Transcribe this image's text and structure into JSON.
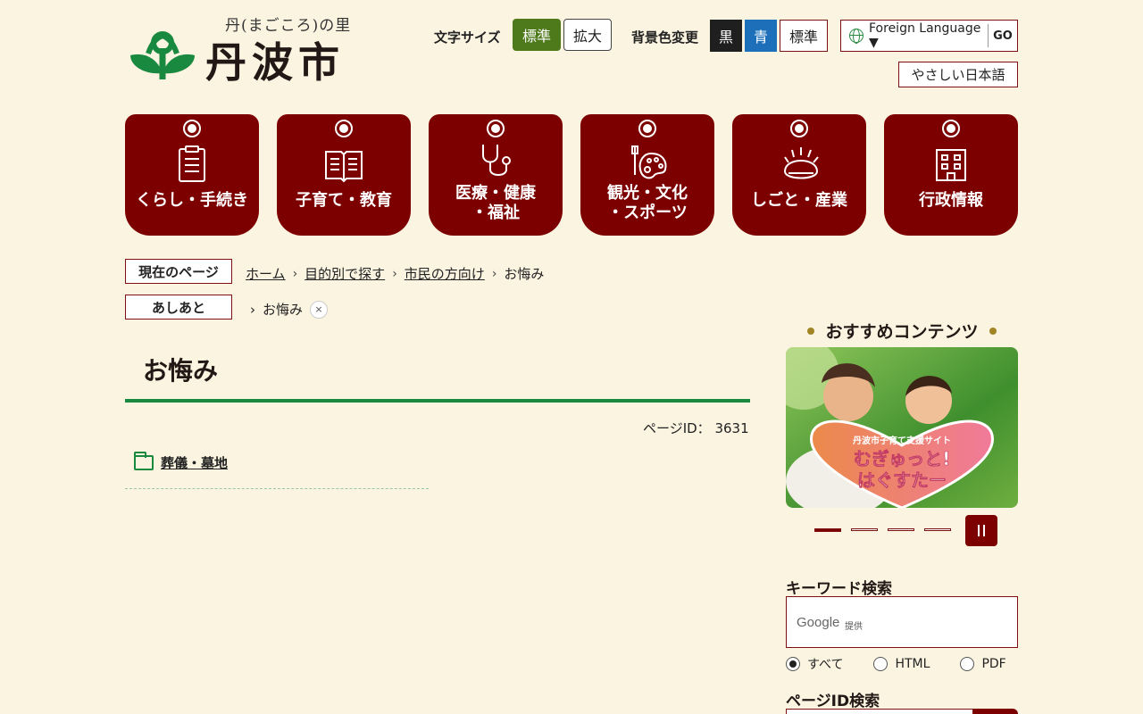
{
  "header": {
    "tagline": "丹(まごころ)の里",
    "city_name": "丹波市",
    "font_size_label": "文字サイズ",
    "font_size_standard": "標準",
    "font_size_large": "拡大",
    "bg_label": "背景色変更",
    "bg_black": "黒",
    "bg_blue": "青",
    "bg_standard": "標準",
    "foreign_language": "Foreign Language",
    "go": "GO",
    "easy_japanese": "やさしい日本語"
  },
  "nav": [
    {
      "label": "くらし・手続き",
      "icon": "clipboard-icon"
    },
    {
      "label": "子育て・教育",
      "icon": "book-icon"
    },
    {
      "label1": "医療・健康",
      "label2": "・福祉",
      "icon": "stethoscope-icon"
    },
    {
      "label1": "観光・文化",
      "label2": "・スポーツ",
      "icon": "palette-icon"
    },
    {
      "label": "しごと・産業",
      "icon": "chestnut-icon"
    },
    {
      "label": "行政情報",
      "icon": "building-icon"
    }
  ],
  "breadcrumb": {
    "current_tag": "現在のページ",
    "items": [
      "ホーム",
      "目的別で探す",
      "市民の方向け"
    ],
    "current": "お悔み"
  },
  "history": {
    "tag": "あしあと",
    "item": "お悔み",
    "remove": "×"
  },
  "main": {
    "title": "お悔み",
    "page_id_label": "ページID：",
    "page_id": "3631",
    "links": [
      "葬儀・墓地"
    ]
  },
  "sidebar": {
    "recommended_title": "おすすめコンテンツ",
    "banner": {
      "subtitle": "丹波市子育て支援サイト",
      "line1": "むぎゅっと!",
      "line2": "はぐすたー"
    },
    "keyword_title": "キーワード検索",
    "google": "Google",
    "provided": "提供",
    "radio_all": "すべて",
    "radio_html": "HTML",
    "radio_pdf": "PDF",
    "page_id_title": "ページID検索"
  },
  "colors": {
    "accent": "#7d0000",
    "green": "#19893f",
    "background": "#faf4e1"
  }
}
